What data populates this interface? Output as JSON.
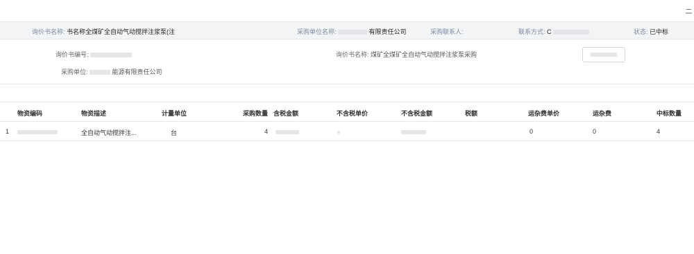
{
  "window": {
    "corner_glyph": "ニ"
  },
  "summary": {
    "inquiry_name_label": "询价书名称:",
    "inquiry_name_value": "书名称全煤矿全自动气动搅拌注浆泵(注",
    "purchaser_label": "采购单位名称:",
    "purchaser_value": "有限责任公司",
    "contact_label": "采购联系人:",
    "contact_value": "",
    "phone_label": "联系方式:",
    "phone_value": "C",
    "status_label": "状态:",
    "status_value": "已中标"
  },
  "detail": {
    "number_label": "询价书编号:",
    "number_value": "",
    "name_label": "询价书名称:",
    "name_value": "煤矿全煤矿全自动气动搅拌注浆泵采购",
    "unit_label": "采购单位:",
    "unit_value": "能源有限责任公司",
    "action_label": ""
  },
  "table": {
    "headers": [
      "物资编码",
      "物资描述",
      "计量单位",
      "采购数量",
      "含税金额",
      "不含税单价",
      "不含税金额",
      "税额",
      "运杂费单价",
      "运杂费",
      "中标数量"
    ],
    "rows": [
      {
        "index": "1",
        "code": "",
        "description": "全自动气动搅拌注...",
        "unit": "台",
        "quantity": "4",
        "tax_amount": "",
        "unit_price_ex_tax": "",
        "amount_ex_tax": "",
        "tax": "",
        "freight_unit_price": "0",
        "freight": "0",
        "awarded_quantity": "4"
      }
    ]
  }
}
